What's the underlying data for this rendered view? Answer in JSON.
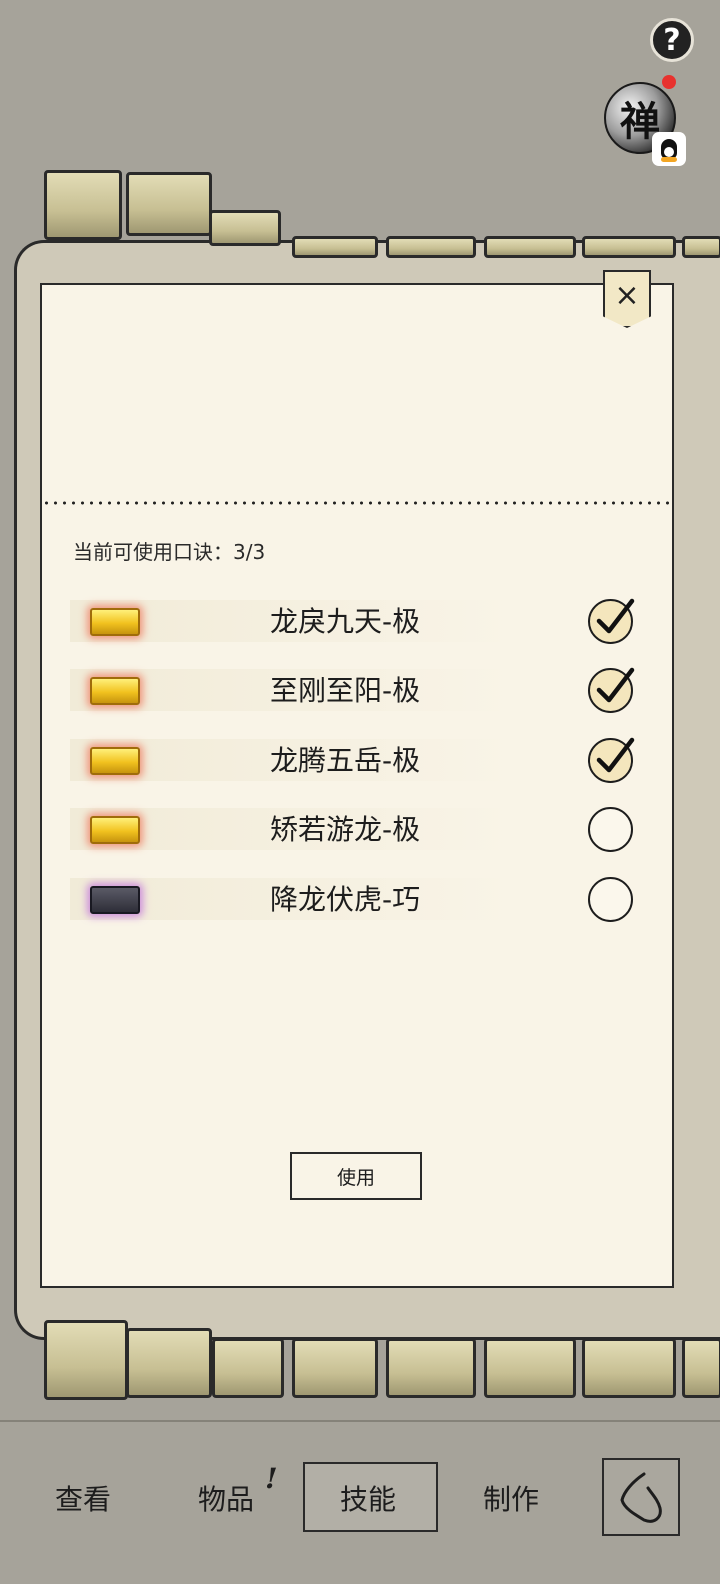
{
  "top_icons": {
    "help_symbol": "?",
    "avatar_char": "禅"
  },
  "dialog": {
    "close_symbol": "×",
    "count_label": "当前可使用口诀：3/3",
    "skills": [
      {
        "name": "龙戾九天-极",
        "selected": true,
        "book": "gold"
      },
      {
        "name": "至刚至阳-极",
        "selected": true,
        "book": "gold"
      },
      {
        "name": "龙腾五岳-极",
        "selected": true,
        "book": "gold"
      },
      {
        "name": "矫若游龙-极",
        "selected": false,
        "book": "gold"
      },
      {
        "name": "降龙伏虎-巧",
        "selected": false,
        "book": "dark"
      }
    ],
    "use_button": "使用"
  },
  "bottom_nav": {
    "items": [
      "查看",
      "物品",
      "技能",
      "制作"
    ],
    "selected": "技能",
    "notice_mark": "!"
  }
}
